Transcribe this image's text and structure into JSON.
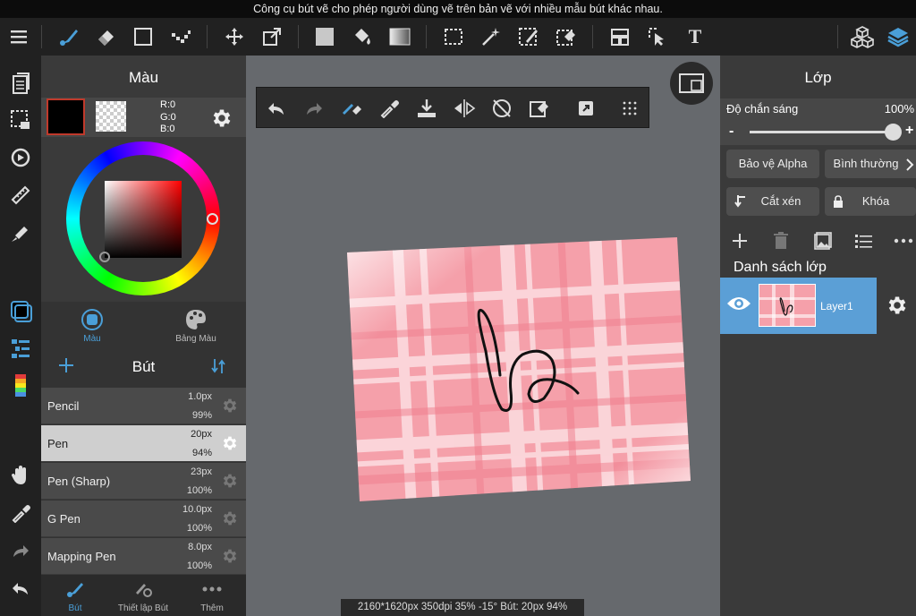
{
  "tooltip": "Công cụ bút vẽ cho phép người dùng vẽ trên bản vẽ với nhiều mẫu bút khác nhau.",
  "toolbar": {
    "text_tool_glyph": "T"
  },
  "color_panel": {
    "title": "Màu",
    "rgb": {
      "r": "R:0",
      "g": "G:0",
      "b": "B:0"
    },
    "foreground": "#000000",
    "tab_color": "Màu",
    "tab_palette": "Bảng Màu"
  },
  "brush_panel": {
    "title": "Bút",
    "brushes": [
      {
        "name": "Pencil",
        "size": "1.0px",
        "opacity": "99%"
      },
      {
        "name": "Pen",
        "size": "20px",
        "opacity": "94%"
      },
      {
        "name": "Pen (Sharp)",
        "size": "23px",
        "opacity": "100%"
      },
      {
        "name": "G Pen",
        "size": "10.0px",
        "opacity": "100%"
      },
      {
        "name": "Mapping Pen",
        "size": "8.0px",
        "opacity": "100%"
      }
    ],
    "tabs": {
      "brush": "Bút",
      "settings": "Thiết lập Bút",
      "more": "Thêm"
    }
  },
  "layer_panel": {
    "title": "Lớp",
    "opacity_label": "Độ chắn sáng",
    "opacity_value": "100%",
    "opacity": 1.0,
    "minus": "-",
    "plus": "+",
    "protect_alpha": "Bảo vệ Alpha",
    "blend_mode": "Bình thường",
    "clipping": "Cắt xén",
    "lock": "Khóa",
    "list_title": "Danh sách lớp",
    "layers": [
      {
        "name": "Layer1"
      }
    ]
  },
  "status": "2160*1620px 350dpi 35% -15° Bút: 20px 94%",
  "colors": {
    "accent": "#4a9fd8",
    "selected_layer": "#5b9fd6",
    "canvas_pink": "#f5a0aa"
  }
}
